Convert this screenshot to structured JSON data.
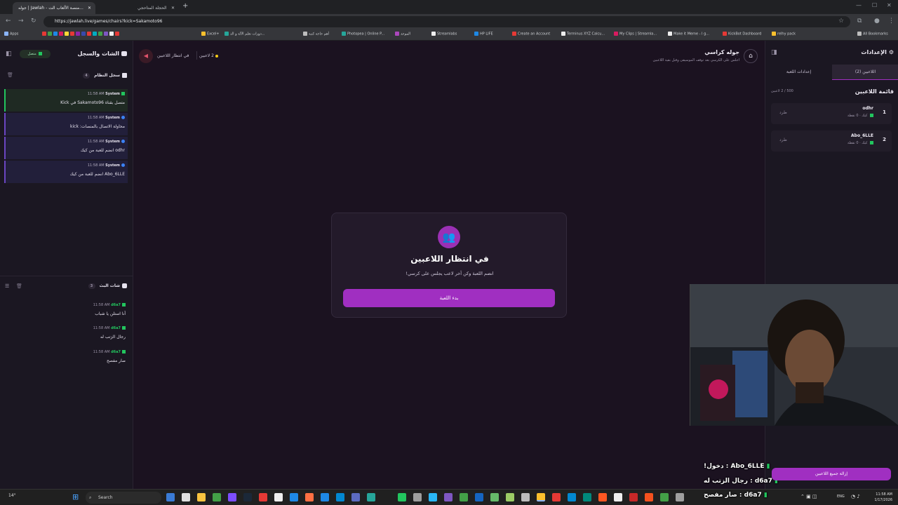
{
  "browser": {
    "tabs": [
      {
        "label": "جوله | Jawlah - منصة الألعاب الت...",
        "active": true
      },
      {
        "label": "الحجلة المتاحجي",
        "active": false
      }
    ],
    "url": "https://jawlah.live/games/chairs?kick=Sakamoto96",
    "bookmarks": [
      "Apps",
      "Excel+",
      "دورات تعلم الآلة و الذ...",
      "أهم حاجة كتبة",
      "Photopea | Online P...",
      "الموعد",
      "Streamlabs",
      "HP LIFE",
      "Create an Account",
      "Terminus XYZ Calcu...",
      "My Clips | Streamla...",
      "Make it Meme - I g...",
      "KickBot Dashboard",
      "relhy pack",
      "All Bookmarks"
    ]
  },
  "left_panel": {
    "title": "الشات والسجل",
    "status": "متصل",
    "system_log": {
      "title": "سجل النظام",
      "count": "4",
      "messages": [
        {
          "sender": "System",
          "time": "11:58 AM",
          "text": "متصل بقناة Sakamoto96 في Kick"
        },
        {
          "sender": "System",
          "time": "11:58 AM",
          "text": "محاولة الاتصال بالمنصات: kick"
        },
        {
          "sender": "System",
          "time": "11:58 AM",
          "text": "odhr انضم للعبة من كيك"
        },
        {
          "sender": "System",
          "time": "11:58 AM",
          "text": "Abo_6LLE انضم للعبة من كيك"
        }
      ]
    },
    "live_chat": {
      "title": "شات البث",
      "count": "3",
      "messages": [
        {
          "user": "d6a7",
          "time": "11:58 AM",
          "text": "أنا استلن يا شباب"
        },
        {
          "user": "d6a7",
          "time": "11:58 AM",
          "text": "رجال الزتب له"
        },
        {
          "user": "d6a7",
          "time": "11:58 AM",
          "text": "صار مفصح"
        }
      ]
    }
  },
  "header": {
    "game_title": "جوله كراسي",
    "game_subtitle": "اجلس على الكرسي بعد توقف الموسيقى وقبل بقية اللاعبين",
    "players_count": "2 لاعبين",
    "status": "في انتظار اللاعبين"
  },
  "waiting_card": {
    "title": "في انتظار اللاعبين",
    "subtitle": "انضم اللعبة وكن أخر لاعب يجلس على كرسي!",
    "start_button": "بدء اللعبة"
  },
  "right_panel": {
    "title": "الإعدادات",
    "tabs": [
      {
        "label": "اللاعبين (2)",
        "active": true
      },
      {
        "label": "إعدادات اللعبة",
        "active": false
      }
    ],
    "player_list_title": "قائمة اللاعبين",
    "player_capacity": "500 / 2 لاعبين",
    "players": [
      {
        "rank": "1",
        "name": "odhr",
        "platform": "كيك",
        "points": "0 نقطة",
        "kick_label": "طرد"
      },
      {
        "rank": "2",
        "name": "Abo_6LLE",
        "platform": "كيك",
        "points": "0 نقطة",
        "kick_label": "طرد"
      }
    ],
    "remove_all_button": "إزالة جميع اللاعبين"
  },
  "overlay_chat": [
    {
      "user": "Abo_6LLE",
      "text": "دخول!"
    },
    {
      "user": "d6a7",
      "text": "رجال الزتب له"
    },
    {
      "user": "d6a7",
      "text": "صار مفصح"
    }
  ],
  "taskbar": {
    "search": "Search",
    "lang": "ENG",
    "time": "11:58 AM",
    "date": "1/17/2026",
    "weather": "14°"
  },
  "colors": {
    "accent": "#a02fc1",
    "online": "#22c55e",
    "background": "#1b1220"
  }
}
